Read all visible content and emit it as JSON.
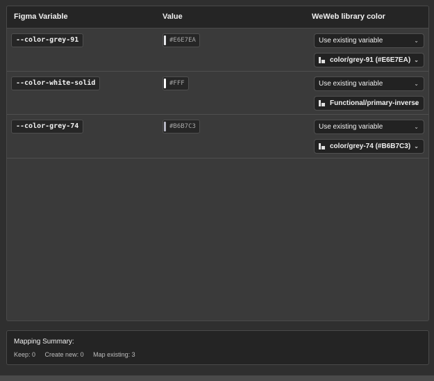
{
  "table": {
    "headers": {
      "figma_variable": "Figma Variable",
      "value": "Value",
      "weweb_library_color": "WeWeb library color"
    },
    "rows": [
      {
        "variable": "--color-grey-91",
        "value": "#E6E7EA",
        "swatch_color": "#E6E7EA",
        "mode": "Use existing variable",
        "selected_variable": "color/grey-91 (#E6E7EA)"
      },
      {
        "variable": "--color-white-solid",
        "value": "#FFF",
        "swatch_color": "#FFFFFF",
        "mode": "Use existing variable",
        "selected_variable": "Functional/primary-inverse"
      },
      {
        "variable": "--color-grey-74",
        "value": "#B6B7C3",
        "swatch_color": "#B6B7C3",
        "mode": "Use existing variable",
        "selected_variable": "color/grey-74 (#B6B7C3)"
      }
    ]
  },
  "summary": {
    "title": "Mapping Summary:",
    "keep": "Keep: 0",
    "create_new": "Create new: 0",
    "map_existing": "Map existing: 3"
  },
  "icons": {
    "chevron": "chevron-down-icon",
    "variable": "color-variable-icon"
  },
  "colors": {
    "background": "#2f2f2f",
    "panel": "#3a3a3a",
    "header": "#252525",
    "control": "#222222"
  }
}
